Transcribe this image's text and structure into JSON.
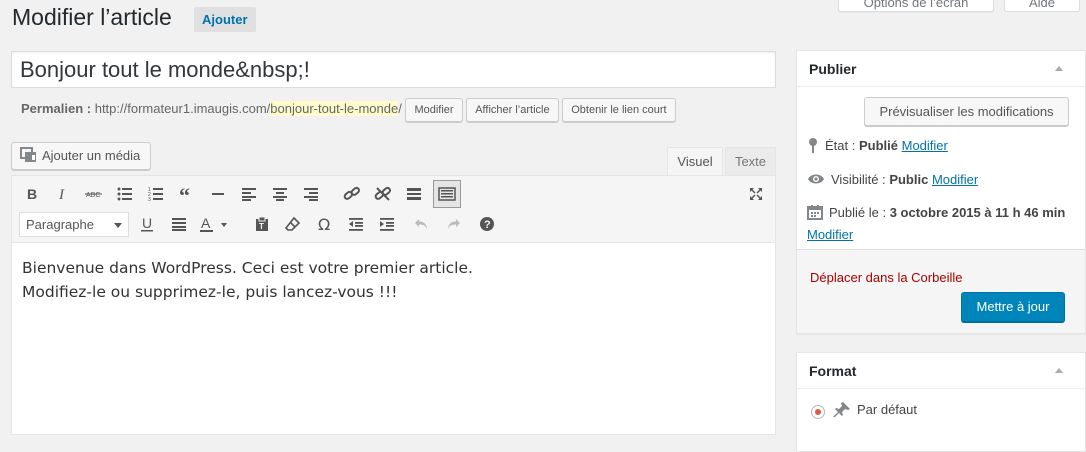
{
  "header": {
    "title": "Modifier l’article",
    "add_new": "Ajouter",
    "screen_options": "Options de l’écran",
    "help": "Aide"
  },
  "post": {
    "title": "Bonjour tout le monde&nbsp;!",
    "permalink_label": "Permalien :",
    "permalink_base": "http://formateur1.imaugis.com/",
    "permalink_slug": "bonjour-tout-le-monde",
    "permalink_end": "/",
    "btn_edit": "Modifier",
    "btn_view": "Afficher l’article",
    "btn_shortlink": "Obtenir le lien court"
  },
  "editor": {
    "add_media": "Ajouter un média",
    "tab_visual": "Visuel",
    "tab_text": "Texte",
    "format_select": "Paragraphe",
    "content_line1": "Bienvenue dans WordPress. Ceci est votre premier article.",
    "content_line2": "Modifiez-le ou supprimez-le, puis lancez-vous !!!"
  },
  "publish_box": {
    "title": "Publier",
    "preview": "Prévisualiser les modifications",
    "status_label": "État :",
    "status_value": "Publié",
    "visibility_label": "Visibilité :",
    "visibility_value": "Public",
    "published_label": "Publié le :",
    "published_value": "3 octobre 2015 à 11 h 46 min",
    "edit_link": "Modifier",
    "trash": "Déplacer dans la Corbeille",
    "update": "Mettre à jour"
  },
  "format_box": {
    "title": "Format",
    "default": "Par défaut"
  },
  "icons": [
    "media-icon",
    "bold-icon",
    "italic-icon",
    "strikethrough-icon",
    "bullet-list-icon",
    "numbered-list-icon",
    "blockquote-icon",
    "horizontal-rule-icon",
    "align-left-icon",
    "align-center-icon",
    "align-right-icon",
    "link-icon",
    "unlink-icon",
    "read-more-icon",
    "toolbar-toggle-icon",
    "fullscreen-icon",
    "underline-icon",
    "justify-icon",
    "text-color-icon",
    "paste-text-icon",
    "clear-formatting-icon",
    "special-char-icon",
    "outdent-icon",
    "indent-icon",
    "undo-icon",
    "redo-icon",
    "help-icon",
    "pin-icon",
    "eye-icon",
    "calendar-icon",
    "pushpin-icon"
  ],
  "colors": {
    "primary": "#0085ba",
    "link": "#0073aa",
    "danger": "#a00",
    "slug_highlight": "#fffbcc"
  }
}
